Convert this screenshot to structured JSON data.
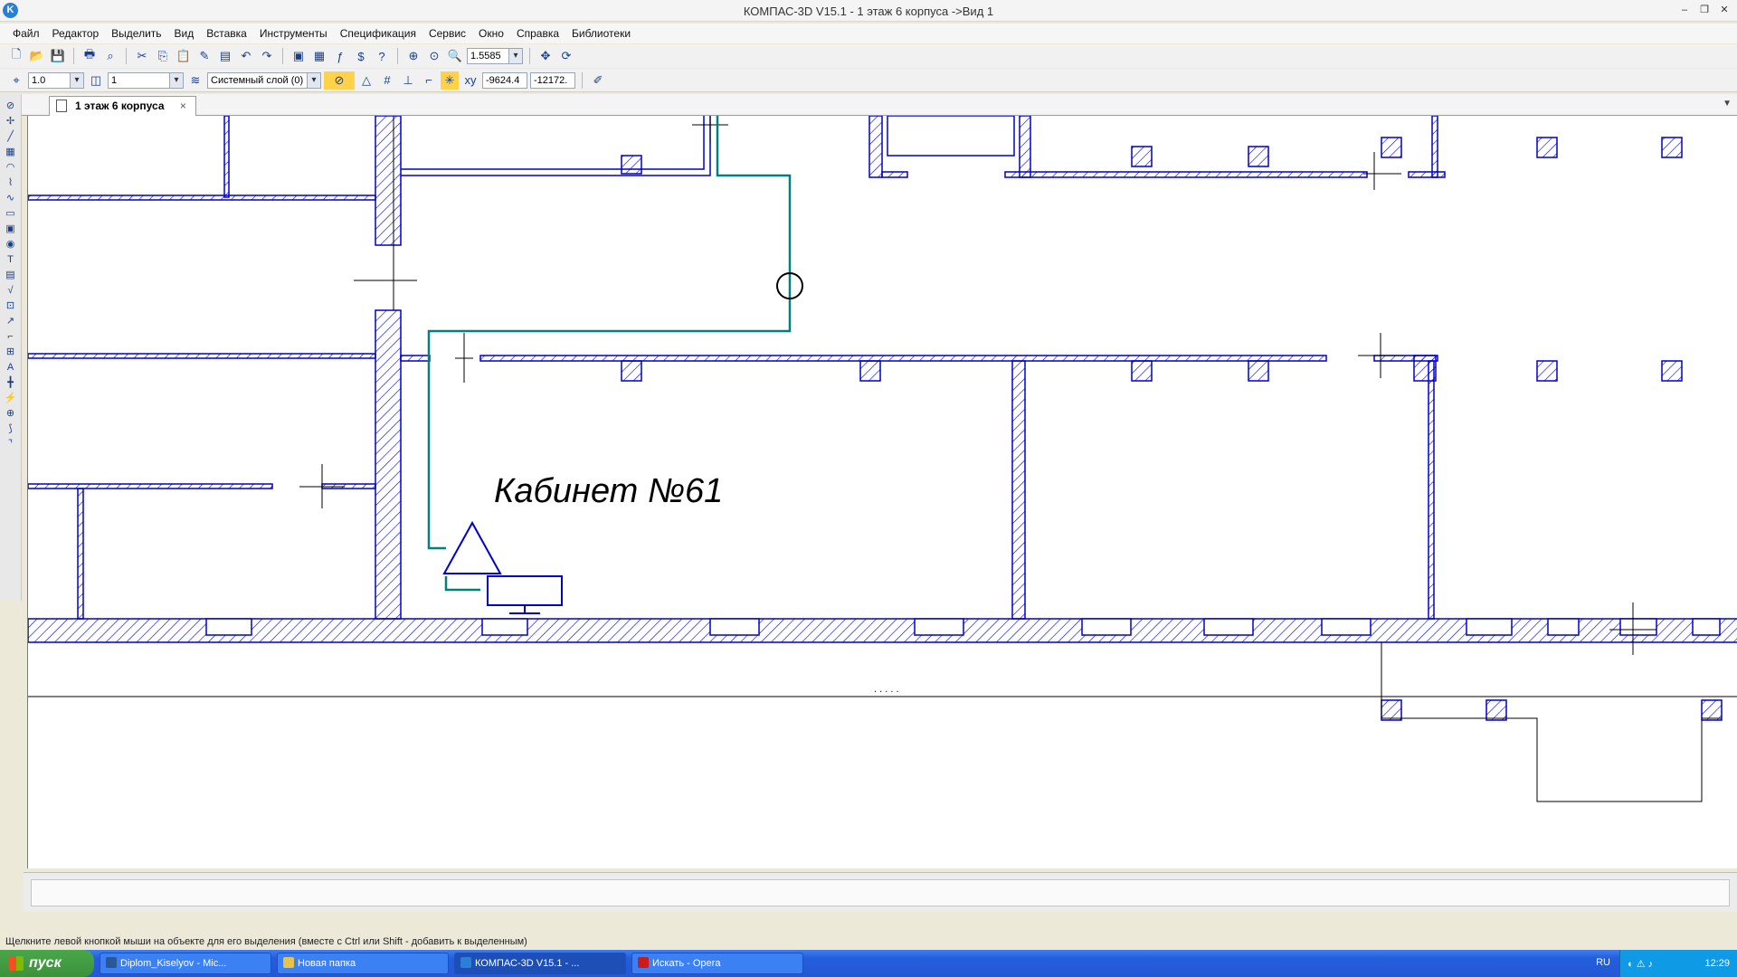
{
  "window": {
    "title": "КОМПАС-3D V15.1 - 1 этаж 6 корпуса ->Вид 1",
    "app_icon": "K"
  },
  "menu": [
    "Файл",
    "Редактор",
    "Выделить",
    "Вид",
    "Вставка",
    "Инструменты",
    "Спецификация",
    "Сервис",
    "Окно",
    "Справка",
    "Библиотеки"
  ],
  "toolbar": {
    "zoom_value": "1.5585",
    "step_value": "1.0",
    "view_value": "1",
    "layer_value": "Системный слой (0)",
    "coord_x": "-9624.4",
    "coord_y": "-12172."
  },
  "document_tab": {
    "label": "1 этаж 6 корпуса",
    "close": "×"
  },
  "drawing": {
    "room_label": "Кабинет №61",
    "line_color": "#0000cc",
    "cable_color": "#008080",
    "dots": ". . . . ."
  },
  "status": {
    "hint": "Щелкните левой кнопкой мыши на объекте для его выделения (вместе с Ctrl или Shift - добавить к выделенным)"
  },
  "taskbar": {
    "start_label": "пуск",
    "tasks": [
      {
        "label": "Diplom_Kiselyov - Mic...",
        "icon_color": "#2b5797"
      },
      {
        "label": "Новая папка",
        "icon_color": "#e8c34a"
      },
      {
        "label": "КОМПАС-3D V15.1 - ...",
        "icon_color": "#2a7fd6"
      },
      {
        "label": "Искать - Opera",
        "icon_color": "#cc1b1b"
      }
    ],
    "lang": "RU",
    "clock": "12:29"
  }
}
